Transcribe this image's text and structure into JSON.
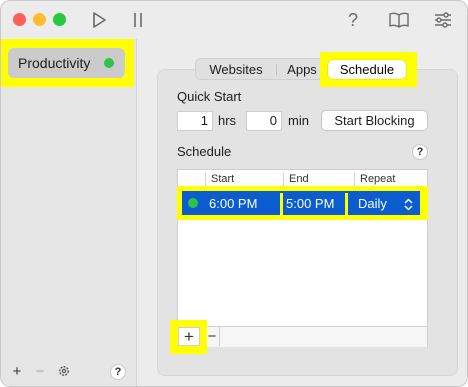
{
  "toolbar": {
    "icons": [
      "play-icon",
      "pause-icon",
      "help-icon",
      "book-icon",
      "sliders-icon"
    ],
    "help_glyph": "?"
  },
  "sidebar": {
    "items": [
      {
        "label": "Productivity",
        "status": "active",
        "status_color": "#2ec24a"
      }
    ],
    "footer": {
      "add_glyph": "+",
      "remove_glyph": "−",
      "help_glyph": "?"
    }
  },
  "tabs": [
    {
      "label": "Websites",
      "selected": false
    },
    {
      "label": "Apps",
      "selected": false
    },
    {
      "label": "Schedule",
      "selected": true
    }
  ],
  "quick_start": {
    "title": "Quick Start",
    "hours_value": "1",
    "hours_unit": "hrs",
    "minutes_value": "0",
    "minutes_unit": "min",
    "start_button": "Start Blocking"
  },
  "schedule": {
    "title": "Schedule",
    "help_glyph": "?",
    "columns": [
      "Start",
      "End",
      "Repeat"
    ],
    "rows": [
      {
        "enabled": true,
        "start": "6:00 PM",
        "end": "5:00 PM",
        "repeat": "Daily"
      }
    ],
    "add_glyph": "+",
    "remove_glyph": "−"
  },
  "colors": {
    "highlight": "#ffff00",
    "selection": "#0b5ccf",
    "green_dot": "#2ec24a"
  }
}
